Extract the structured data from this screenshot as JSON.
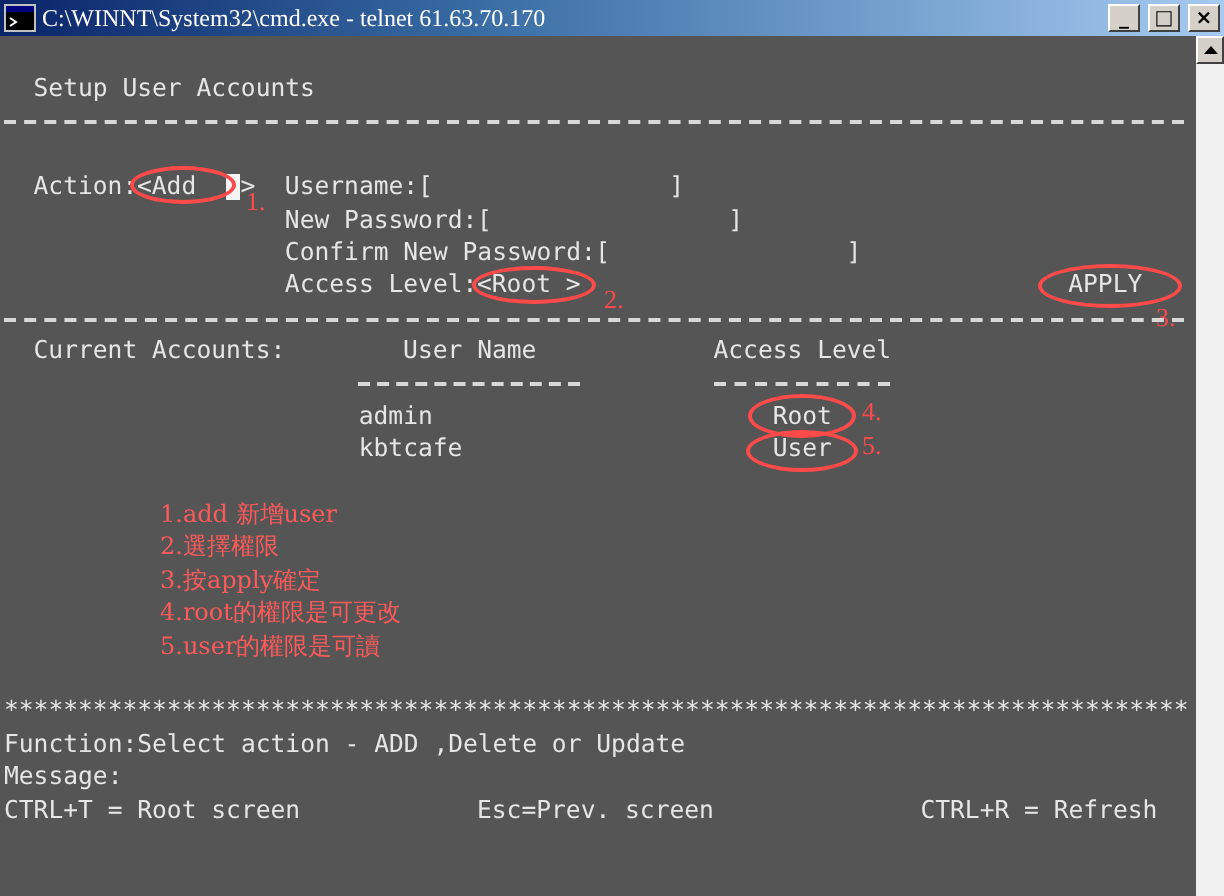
{
  "window": {
    "title": "C:\\WINNT\\System32\\cmd.exe - telnet 61.63.70.170",
    "controls": [
      "_",
      "□",
      "×"
    ]
  },
  "screen": {
    "heading": "Setup User Accounts",
    "form": {
      "action_label": "Action:",
      "action_open": "<",
      "action_value": "Add",
      "action_close": ">",
      "fields": [
        {
          "label": "Username:",
          "open": "[",
          "close": "]"
        },
        {
          "label": "New Password:",
          "open": "[",
          "close": "]"
        },
        {
          "label": "Confirm New Password:",
          "open": "[",
          "close": "]"
        }
      ],
      "access_label": "Access Level:",
      "access_value": "<Root >",
      "apply": "APPLY"
    },
    "accounts": {
      "label": "Current Accounts:",
      "columns": [
        "User Name",
        "Access Level"
      ],
      "rows": [
        {
          "user": "admin",
          "level": "Root"
        },
        {
          "user": "kbtcafe",
          "level": "User"
        }
      ]
    },
    "separator": "********************************************************************************",
    "function": "Function:Select action - ADD ,Delete or Update",
    "message": "Message:",
    "keys": [
      "CTRL+T = Root screen",
      "Esc=Prev. screen",
      "CTRL+R = Refresh"
    ]
  },
  "annotations": {
    "markers": [
      {
        "label": "1."
      },
      {
        "label": "2."
      },
      {
        "label": "3."
      },
      {
        "label": "4."
      },
      {
        "label": "5."
      }
    ],
    "notes": [
      "1.add 新增user",
      "2.選擇權限",
      "3.按apply確定",
      "4.root的權限是可更改",
      "5.user的權限是可讀"
    ]
  }
}
